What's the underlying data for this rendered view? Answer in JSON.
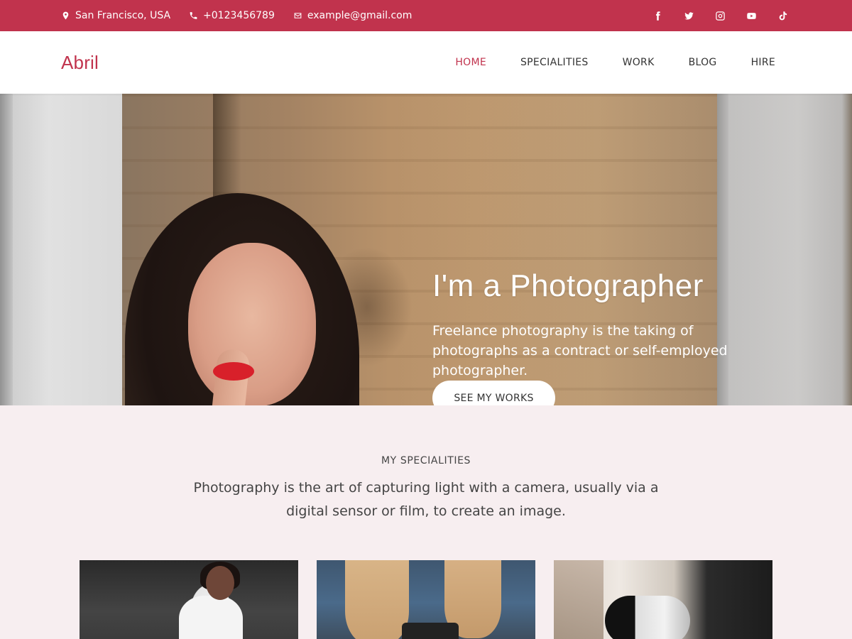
{
  "topbar": {
    "location": "San Francisco, USA",
    "phone": "+0123456789",
    "email": "example@gmail.com",
    "socials": [
      "facebook-icon",
      "twitter-icon",
      "instagram-icon",
      "youtube-icon",
      "tiktok-icon"
    ]
  },
  "header": {
    "logo": "Abril",
    "nav": [
      "HOME",
      "SPECIALITIES",
      "WORK",
      "BLOG",
      "HIRE"
    ],
    "active": "HOME"
  },
  "hero": {
    "title": "I'm a Photographer",
    "subtitle": "Freelance photography is the taking of photographs as a contract or self-employed photographer.",
    "button": "SEE MY WORKS"
  },
  "specialities": {
    "eyebrow": "MY SPECIALITIES",
    "description": "Photography is the art of capturing light with a camera, usually via a digital sensor or film, to create an image."
  },
  "colors": {
    "accent": "#c1334d",
    "section_bg": "#f7eef0"
  }
}
